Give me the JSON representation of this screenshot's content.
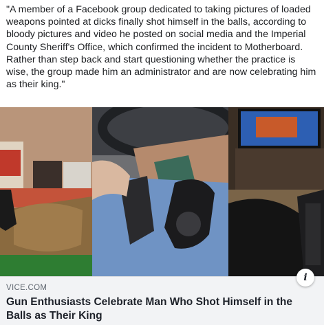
{
  "post": {
    "text": "\"A member of a Facebook group dedicated to taking pictures of loaded weapons pointed at dicks finally shot himself in the balls, according to bloody pictures and video he posted on social media and the Imperial County Sheriff's Office, which confirmed the incident to Motherboard. Rather than step back and start questioning whether the practice is wise, the group made him an administrator and are now celebrating him as their king.\""
  },
  "link_preview": {
    "domain": "VICE.COM",
    "headline": "Gun Enthusiasts Celebrate Man Who Shot Himself in the Balls as Their King",
    "info_icon": "info-icon"
  }
}
